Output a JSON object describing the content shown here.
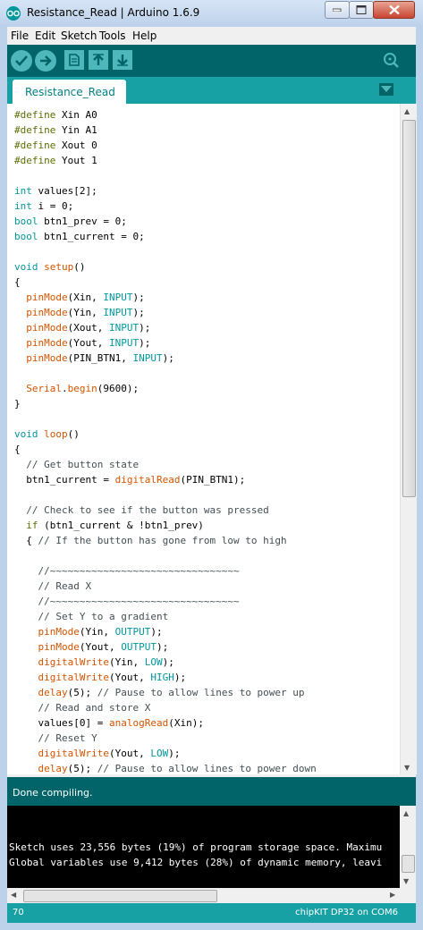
{
  "window": {
    "title": "Resistance_Read | Arduino 1.6.9"
  },
  "menu": [
    "File",
    "Edit",
    "Sketch",
    "Tools",
    "Help"
  ],
  "toolbar": {
    "verify_icon": "check-icon",
    "upload_icon": "arrow-right-icon",
    "new_icon": "document-icon",
    "open_icon": "arrow-up-icon",
    "save_icon": "arrow-down-icon",
    "serial_monitor_icon": "magnifier-icon"
  },
  "tab": {
    "label": "Resistance_Read"
  },
  "code_lines": [
    [
      {
        "t": "#define",
        "c": "kw-define"
      },
      {
        "t": " Xin A0"
      }
    ],
    [
      {
        "t": "#define",
        "c": "kw-define"
      },
      {
        "t": " Yin A1"
      }
    ],
    [
      {
        "t": "#define",
        "c": "kw-define"
      },
      {
        "t": " Xout 0"
      }
    ],
    [
      {
        "t": "#define",
        "c": "kw-define"
      },
      {
        "t": " Yout 1"
      }
    ],
    [],
    [
      {
        "t": "int",
        "c": "kw-type"
      },
      {
        "t": " values[2];"
      }
    ],
    [
      {
        "t": "int",
        "c": "kw-type"
      },
      {
        "t": " i = 0;"
      }
    ],
    [
      {
        "t": "bool",
        "c": "kw-type"
      },
      {
        "t": " btn1_prev = 0;"
      }
    ],
    [
      {
        "t": "bool",
        "c": "kw-type"
      },
      {
        "t": " btn1_current = 0;"
      }
    ],
    [],
    [
      {
        "t": "void",
        "c": "kw-type"
      },
      {
        "t": " "
      },
      {
        "t": "setup",
        "c": "kw-func"
      },
      {
        "t": "()"
      }
    ],
    [
      {
        "t": "{"
      }
    ],
    [
      {
        "t": "  "
      },
      {
        "t": "pinMode",
        "c": "kw-func"
      },
      {
        "t": "(Xin, "
      },
      {
        "t": "INPUT",
        "c": "kw-const"
      },
      {
        "t": ");"
      }
    ],
    [
      {
        "t": "  "
      },
      {
        "t": "pinMode",
        "c": "kw-func"
      },
      {
        "t": "(Yin, "
      },
      {
        "t": "INPUT",
        "c": "kw-const"
      },
      {
        "t": ");"
      }
    ],
    [
      {
        "t": "  "
      },
      {
        "t": "pinMode",
        "c": "kw-func"
      },
      {
        "t": "(Xout, "
      },
      {
        "t": "INPUT",
        "c": "kw-const"
      },
      {
        "t": ");"
      }
    ],
    [
      {
        "t": "  "
      },
      {
        "t": "pinMode",
        "c": "kw-func"
      },
      {
        "t": "(Yout, "
      },
      {
        "t": "INPUT",
        "c": "kw-const"
      },
      {
        "t": ");"
      }
    ],
    [
      {
        "t": "  "
      },
      {
        "t": "pinMode",
        "c": "kw-func"
      },
      {
        "t": "(PIN_BTN1, "
      },
      {
        "t": "INPUT",
        "c": "kw-const"
      },
      {
        "t": ");"
      }
    ],
    [],
    [
      {
        "t": "  "
      },
      {
        "t": "Serial",
        "c": "kw-func"
      },
      {
        "t": "."
      },
      {
        "t": "begin",
        "c": "kw-func"
      },
      {
        "t": "(9600);"
      }
    ],
    [
      {
        "t": "}"
      }
    ],
    [],
    [
      {
        "t": "void",
        "c": "kw-type"
      },
      {
        "t": " "
      },
      {
        "t": "loop",
        "c": "kw-func"
      },
      {
        "t": "()"
      }
    ],
    [
      {
        "t": "{"
      }
    ],
    [
      {
        "t": "  "
      },
      {
        "t": "// Get button state",
        "c": "cmt"
      }
    ],
    [
      {
        "t": "  btn1_current = "
      },
      {
        "t": "digitalRead",
        "c": "kw-func"
      },
      {
        "t": "(PIN_BTN1);"
      }
    ],
    [],
    [
      {
        "t": "  "
      },
      {
        "t": "// Check to see if the button was pressed",
        "c": "cmt"
      }
    ],
    [
      {
        "t": "  "
      },
      {
        "t": "if",
        "c": "kw-define"
      },
      {
        "t": " (btn1_current & !btn1_prev)"
      }
    ],
    [
      {
        "t": "  { "
      },
      {
        "t": "// If the button has gone from low to high",
        "c": "cmt"
      }
    ],
    [],
    [
      {
        "t": "    "
      },
      {
        "t": "//~~~~~~~~~~~~~~~~~~~~~~~~~~~~~~~~",
        "c": "cmt"
      }
    ],
    [
      {
        "t": "    "
      },
      {
        "t": "// Read X",
        "c": "cmt"
      }
    ],
    [
      {
        "t": "    "
      },
      {
        "t": "//~~~~~~~~~~~~~~~~~~~~~~~~~~~~~~~~",
        "c": "cmt"
      }
    ],
    [
      {
        "t": "    "
      },
      {
        "t": "// Set Y to a gradient",
        "c": "cmt"
      }
    ],
    [
      {
        "t": "    "
      },
      {
        "t": "pinMode",
        "c": "kw-func"
      },
      {
        "t": "(Yin, "
      },
      {
        "t": "OUTPUT",
        "c": "kw-const"
      },
      {
        "t": ");"
      }
    ],
    [
      {
        "t": "    "
      },
      {
        "t": "pinMode",
        "c": "kw-func"
      },
      {
        "t": "(Yout, "
      },
      {
        "t": "OUTPUT",
        "c": "kw-const"
      },
      {
        "t": ");"
      }
    ],
    [
      {
        "t": "    "
      },
      {
        "t": "digitalWrite",
        "c": "kw-func"
      },
      {
        "t": "(Yin, "
      },
      {
        "t": "LOW",
        "c": "kw-const"
      },
      {
        "t": ");"
      }
    ],
    [
      {
        "t": "    "
      },
      {
        "t": "digitalWrite",
        "c": "kw-func"
      },
      {
        "t": "(Yout, "
      },
      {
        "t": "HIGH",
        "c": "kw-const"
      },
      {
        "t": ");"
      }
    ],
    [
      {
        "t": "    "
      },
      {
        "t": "delay",
        "c": "kw-func"
      },
      {
        "t": "(5); "
      },
      {
        "t": "// Pause to allow lines to power up",
        "c": "cmt"
      }
    ],
    [
      {
        "t": "    "
      },
      {
        "t": "// Read and store X",
        "c": "cmt"
      }
    ],
    [
      {
        "t": "    values[0] = "
      },
      {
        "t": "analogRead",
        "c": "kw-func"
      },
      {
        "t": "(Xin);"
      }
    ],
    [
      {
        "t": "    "
      },
      {
        "t": "// Reset Y",
        "c": "cmt"
      }
    ],
    [
      {
        "t": "    "
      },
      {
        "t": "digitalWrite",
        "c": "kw-func"
      },
      {
        "t": "(Yout, "
      },
      {
        "t": "LOW",
        "c": "kw-const"
      },
      {
        "t": ");"
      }
    ],
    [
      {
        "t": "    "
      },
      {
        "t": "delay",
        "c": "kw-func"
      },
      {
        "t": "(5); "
      },
      {
        "t": "// Pause to allow lines to power down",
        "c": "cmt"
      }
    ]
  ],
  "status": {
    "message": "Done compiling."
  },
  "console": {
    "lines": [
      "Sketch uses 23,556 bytes (19%) of program storage space. Maximu",
      "Global variables use 9,412 bytes (28%) of dynamic memory, leavi"
    ]
  },
  "footer": {
    "line_number": "70",
    "board": "chipKIT DP32 on COM6"
  }
}
